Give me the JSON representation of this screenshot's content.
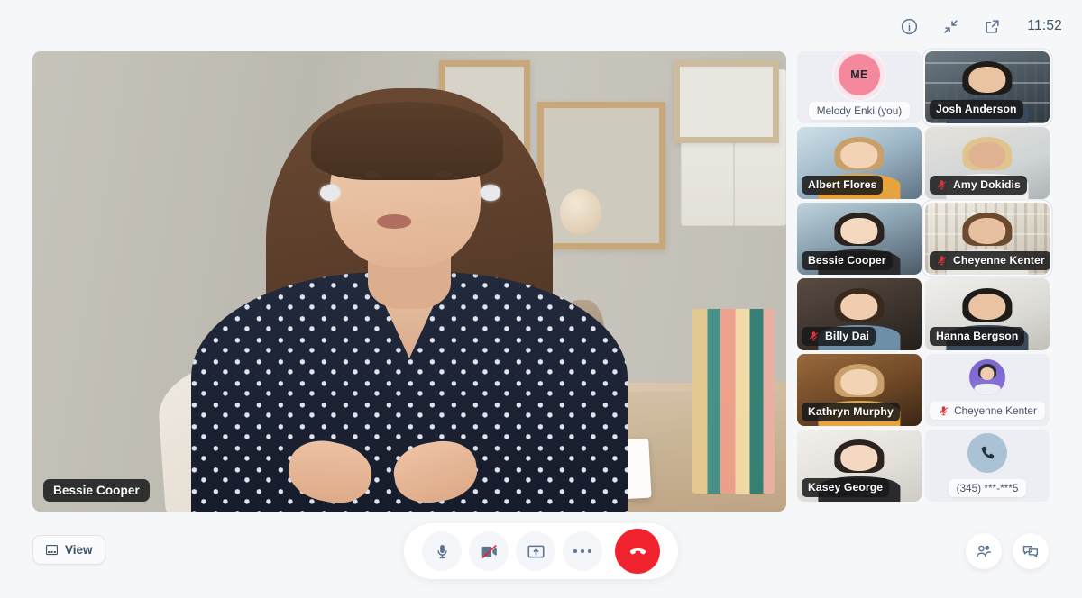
{
  "topbar": {
    "info_icon": "info-icon",
    "collapse_icon": "collapse-arrows-icon",
    "popout_icon": "open-external-icon",
    "time": "11:52"
  },
  "stage": {
    "speaker_name": "Bessie Cooper"
  },
  "sidebar": {
    "tiles": [
      {
        "name": "Melody Enki (you)",
        "type": "self",
        "initials": "ME",
        "muted": false,
        "active": false,
        "scene": "none"
      },
      {
        "name": "Josh Anderson",
        "type": "video",
        "muted": false,
        "active": true,
        "scene": "bg-office"
      },
      {
        "name": "Albert Flores",
        "type": "video",
        "muted": false,
        "active": false,
        "scene": "bg-desk"
      },
      {
        "name": "Amy Dokidis",
        "type": "video",
        "muted": true,
        "active": false,
        "scene": "bg-room"
      },
      {
        "name": "Bessie Cooper",
        "type": "video",
        "muted": false,
        "active": false,
        "scene": "bg-cowork"
      },
      {
        "name": "Cheyenne Kenter",
        "type": "video",
        "muted": true,
        "active": true,
        "scene": "bg-shelf"
      },
      {
        "name": "Billy Dai",
        "type": "video",
        "muted": true,
        "active": false,
        "scene": "bg-cafe"
      },
      {
        "name": "Hanna Bergson",
        "type": "video",
        "muted": false,
        "active": false,
        "scene": "bg-light"
      },
      {
        "name": "Kathryn Murphy",
        "type": "video",
        "muted": false,
        "active": false,
        "scene": "bg-wood"
      },
      {
        "name": "Cheyenne Kenter",
        "type": "avatar",
        "muted": true,
        "active": false,
        "scene": "none"
      },
      {
        "name": "Kasey George",
        "type": "video",
        "muted": false,
        "active": false,
        "scene": "bg-soft"
      },
      {
        "name": "(345) ***-***5",
        "type": "phone",
        "muted": false,
        "active": false,
        "scene": "none"
      }
    ]
  },
  "controls": {
    "view_label": "View",
    "view_icon": "layout-grid-icon",
    "mic_icon": "microphone-icon",
    "camera_icon": "camera-off-icon",
    "share_icon": "screen-share-icon",
    "more_icon": "more-dots-icon",
    "end_icon": "end-call-icon",
    "participants_icon": "participants-icon",
    "chat_icon": "chat-bubbles-icon"
  },
  "colors": {
    "page_bg": "#f6f7f9",
    "accent_red": "#f0232e",
    "self_avatar": "#f4899e",
    "icon": "#5b7490",
    "mute_red": "#e0333a"
  }
}
